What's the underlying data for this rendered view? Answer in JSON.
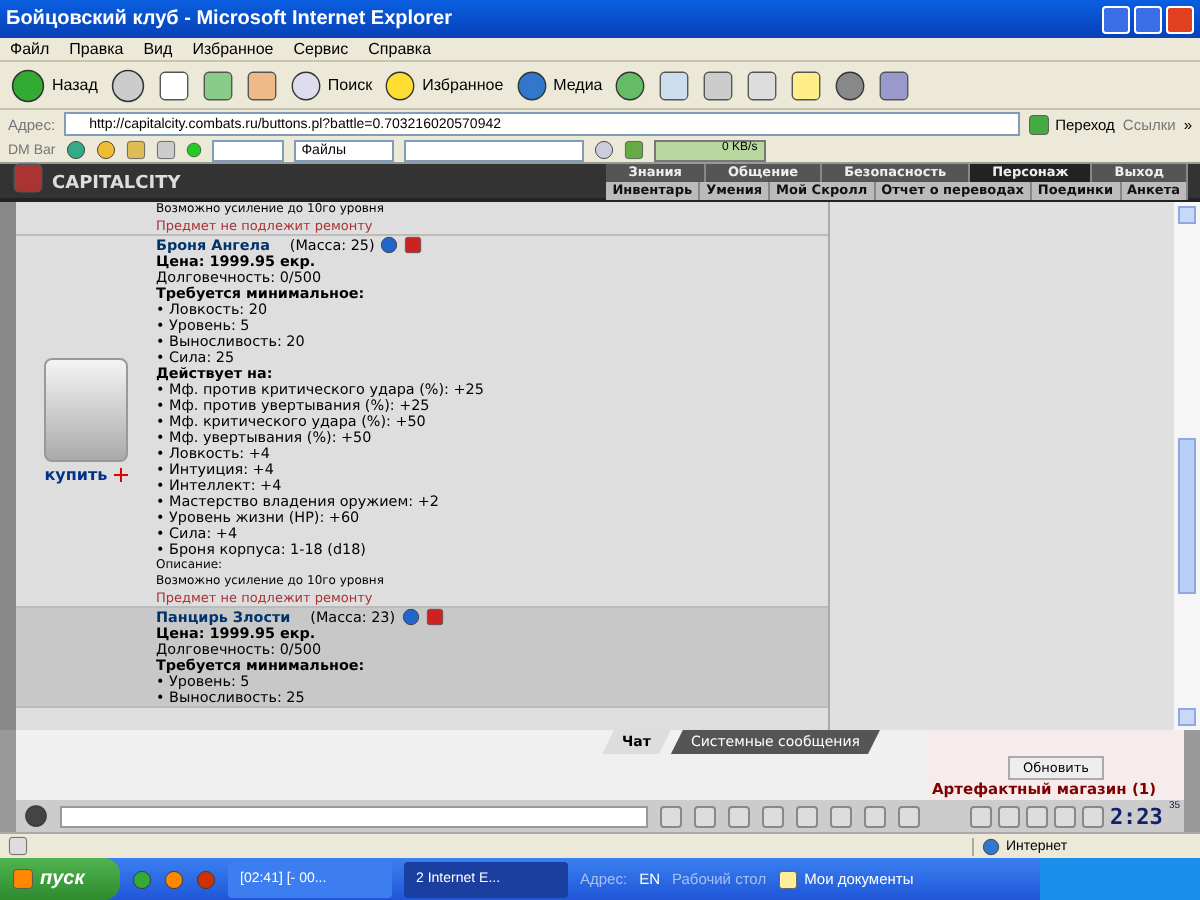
{
  "window": {
    "title": "Бойцовский клуб - Microsoft Internet Explorer"
  },
  "menu": [
    "Файл",
    "Правка",
    "Вид",
    "Избранное",
    "Сервис",
    "Справка"
  ],
  "toolbar": {
    "back": "Назад",
    "search": "Поиск",
    "favorites": "Избранное",
    "media": "Медиа"
  },
  "address_bar": {
    "label": "Адрес:",
    "url": "http://capitalcity.combats.ru/buttons.pl?battle=0.703216020570942",
    "go": "Переход",
    "links": "Ссылки",
    "more": "»"
  },
  "dm_bar": {
    "label": "DM Bar",
    "files": "Файлы",
    "speed": "0 KB/s"
  },
  "game_header": {
    "logo": "CAPITALCITY",
    "top_nav": [
      {
        "label": "Знания",
        "selected": false
      },
      {
        "label": "Общение",
        "selected": false
      },
      {
        "label": "Безопасность",
        "selected": false
      },
      {
        "label": "Персонаж",
        "selected": true
      },
      {
        "label": "Выход",
        "selected": false
      }
    ],
    "sub_nav": [
      "Инвентарь",
      "Умения",
      "Мой Скролл",
      "Отчет о переводах",
      "Поединки",
      "Анкета"
    ]
  },
  "shop": {
    "previous_item_tail": {
      "description": "Возможно усиление до 10го уровня",
      "repair_note": "Предмет не подлежит ремонту"
    },
    "items": [
      {
        "name": "Броня Ангела",
        "mass": "(Масса: 25)",
        "price": "Цена: 1999.95 екр.",
        "durability": "Долговечность: 0/500",
        "requirements_title": "Требуется минимальное:",
        "requirements": [
          "• Ловкость: 20",
          "• Уровень: 5",
          "• Выносливость: 20",
          "• Сила: 25"
        ],
        "effects_title": "Действует на:",
        "effects": [
          "• Мф. против критического удара (%): +25",
          "• Мф. против увертывания (%): +25",
          "• Мф. критического удара (%): +50",
          "• Мф. увертывания (%): +50",
          "• Ловкость: +4",
          "• Интуиция: +4",
          "• Интеллект: +4",
          "• Мастерство владения оружием: +2",
          "• Уровень жизни (HP): +60",
          "• Сила: +4",
          "• Броня корпуса: 1-18 (d18)"
        ],
        "description_label": "Описание:",
        "description": "Возможно усиление до 10го уровня",
        "repair_note": "Предмет не подлежит ремонту",
        "buy_label": "купить"
      },
      {
        "name": "Панцирь Злости",
        "mass": "(Масса: 23)",
        "price": "Цена: 1999.95 екр.",
        "durability": "Долговечность: 0/500",
        "requirements_title": "Требуется минимальное:",
        "requirements": [
          "• Уровень: 5",
          "• Выносливость: 25"
        ]
      }
    ]
  },
  "chat": {
    "tabs": [
      {
        "label": "Чат",
        "selected": true
      },
      {
        "label": "Системные сообщения",
        "selected": false
      }
    ],
    "refresh": "Обновить",
    "room": "Артефактный магазин (1)",
    "clock": "2:23",
    "clock_seconds": "35"
  },
  "status_bar": {
    "zone": "Интернет"
  },
  "taskbar": {
    "start": "пуск",
    "tasks": [
      {
        "label": "[02:41] [- 00...",
        "selected": false
      },
      {
        "label": "2 Internet E...",
        "selected": true
      }
    ],
    "address_label": "Адрес:",
    "language": "EN",
    "desktop": "Рабочий стол",
    "documents": "Мои документы"
  }
}
